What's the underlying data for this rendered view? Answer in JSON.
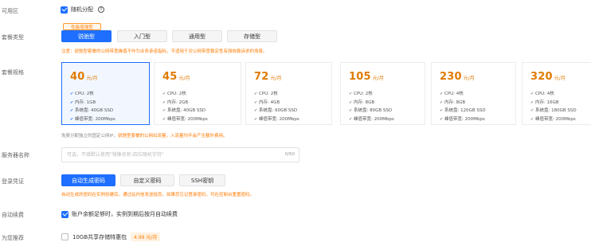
{
  "availability_zone": {
    "label": "可用区",
    "checkbox_label": "随机分配"
  },
  "package_type": {
    "label": "套餐类型",
    "badge": "性能增强型",
    "tabs": [
      "锐驰型",
      "入门型",
      "通用型",
      "存储型"
    ],
    "active_index": 0,
    "note": "注意：锐驰型套餐的公网带宽峰值不作为业务承诺指标，不适用于对公网带宽稳定性有强依赖诉求的场景。"
  },
  "package_spec": {
    "label": "套餐规格",
    "unit": "元/月",
    "selected_index": 0,
    "cards": [
      {
        "price": "40",
        "specs": [
          "CPU: 2核",
          "内存: 1GB",
          "系统盘: 40GB SSD",
          "峰值带宽: 200Mbps"
        ]
      },
      {
        "price": "45",
        "specs": [
          "CPU: 2核",
          "内存: 2GB",
          "系统盘: 40GB SSD",
          "峰值带宽: 200Mbps"
        ]
      },
      {
        "price": "72",
        "specs": [
          "CPU: 2核",
          "内存: 4GB",
          "系统盘: 60GB SSD",
          "峰值带宽: 200Mbps"
        ]
      },
      {
        "price": "105",
        "specs": [
          "CPU: 2核",
          "内存: 8GB",
          "系统盘: 80GB SSD",
          "峰值带宽: 200Mbps"
        ]
      },
      {
        "price": "230",
        "specs": [
          "CPU: 4核",
          "内存: 8GB",
          "系统盘: 120GB SSD",
          "峰值带宽: 200Mbps"
        ]
      },
      {
        "price": "320",
        "specs": [
          "CPU: 4核",
          "内存: 16GB",
          "系统盘: 180GB SSD",
          "峰值带宽: 200Mbps"
        ]
      }
    ],
    "footnote_prefix": "免费分配独立的固定公网IP，",
    "footnote_highlight": "锐驰型套餐的公网出流量，入流量均不会产生额外费用。"
  },
  "server_name": {
    "label": "服务器名称",
    "placeholder": "可选，不填默认使用\"镜像名称-四位随机字符\"",
    "counter": "0/60"
  },
  "login_credential": {
    "label": "登录凭证",
    "tabs": [
      "自动生成密码",
      "自定义密码",
      "SSH密钥"
    ],
    "active_index": 0,
    "note": "自动生成的密码在实例创建后，通过站内信发送给您。如果您忘记登录密码，可在控制台重置密码。"
  },
  "auto_renew": {
    "label": "自动续费",
    "checkbox_label": "账户余额足够时，实例到期后按月自动续费"
  },
  "recommend": {
    "label": "为您推荐",
    "checkbox_label": "10GB共享存储特惠包",
    "price_tag": "4.99 元/月"
  },
  "colors": {
    "primary": "#1e6fff",
    "accent": "#ff7a00",
    "price": "#e07b00"
  }
}
